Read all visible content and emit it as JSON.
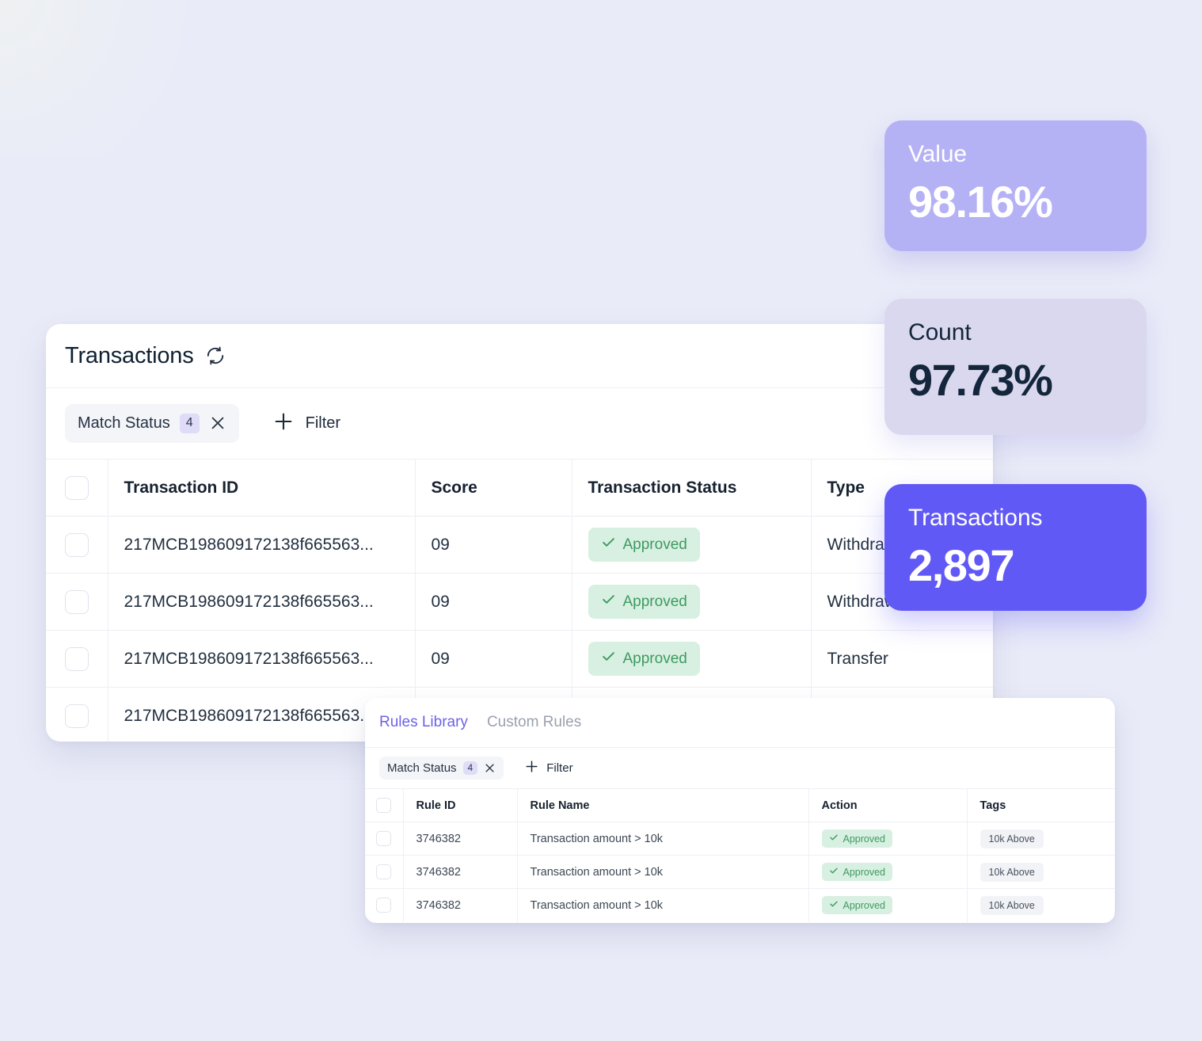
{
  "transactions_panel": {
    "title": "Transactions",
    "refresh_icon": "refresh-icon",
    "filter_bar": {
      "chip_label": "Match Status",
      "chip_count": "4",
      "chip_remove_icon": "close-icon",
      "add_icon": "plus-icon",
      "add_label": "Filter"
    },
    "columns": [
      "Transaction ID",
      "Score",
      "Transaction Status",
      "Type"
    ],
    "rows": [
      {
        "id": "217MCB198609172138f665563...",
        "score": "09",
        "status": "Approved",
        "status_kind": "approved",
        "type": "Withdrawal"
      },
      {
        "id": "217MCB198609172138f665563...",
        "score": "09",
        "status": "Approved",
        "status_kind": "approved",
        "type": "Withdrawal"
      },
      {
        "id": "217MCB198609172138f665563...",
        "score": "09",
        "status": "Approved",
        "status_kind": "approved",
        "type": "Transfer"
      },
      {
        "id": "217MCB198609172138f665563...",
        "score": "",
        "status": "",
        "status_kind": "pending",
        "type": ""
      }
    ]
  },
  "rules_panel": {
    "tabs": [
      {
        "label": "Rules Library",
        "active": true
      },
      {
        "label": "Custom Rules",
        "active": false
      }
    ],
    "filter_bar": {
      "chip_label": "Match Status",
      "chip_count": "4",
      "chip_remove_icon": "close-icon",
      "add_icon": "plus-icon",
      "add_label": "Filter"
    },
    "columns": [
      "Rule ID",
      "Rule Name",
      "Action",
      "Tags"
    ],
    "rows": [
      {
        "rule_id": "3746382",
        "rule_name": "Transaction amount > 10k",
        "action": "Approved",
        "tag": "10k Above"
      },
      {
        "rule_id": "3746382",
        "rule_name": "Transaction amount > 10k",
        "action": "Approved",
        "tag": "10k Above"
      },
      {
        "rule_id": "3746382",
        "rule_name": "Transaction amount > 10k",
        "action": "Approved",
        "tag": "10k Above"
      }
    ]
  },
  "cards": [
    {
      "label": "Value",
      "value": "98.16%",
      "color": "#b5b1f5"
    },
    {
      "label": "Count",
      "value": "97.73%",
      "color": "#dad8ef"
    },
    {
      "label": "Transactions",
      "value": "2,897",
      "color": "#6159f5"
    }
  ],
  "colors": {
    "background": "#e9ebf8",
    "accent": "#6159f5",
    "accent_light": "#b5b1f5",
    "accent_muted": "#dad8ef",
    "badge_approved_bg": "#d8f0e1",
    "badge_approved_text": "#3f9a62",
    "badge_pending_bg": "#fbeec4",
    "tab_active": "#6d63e8"
  }
}
